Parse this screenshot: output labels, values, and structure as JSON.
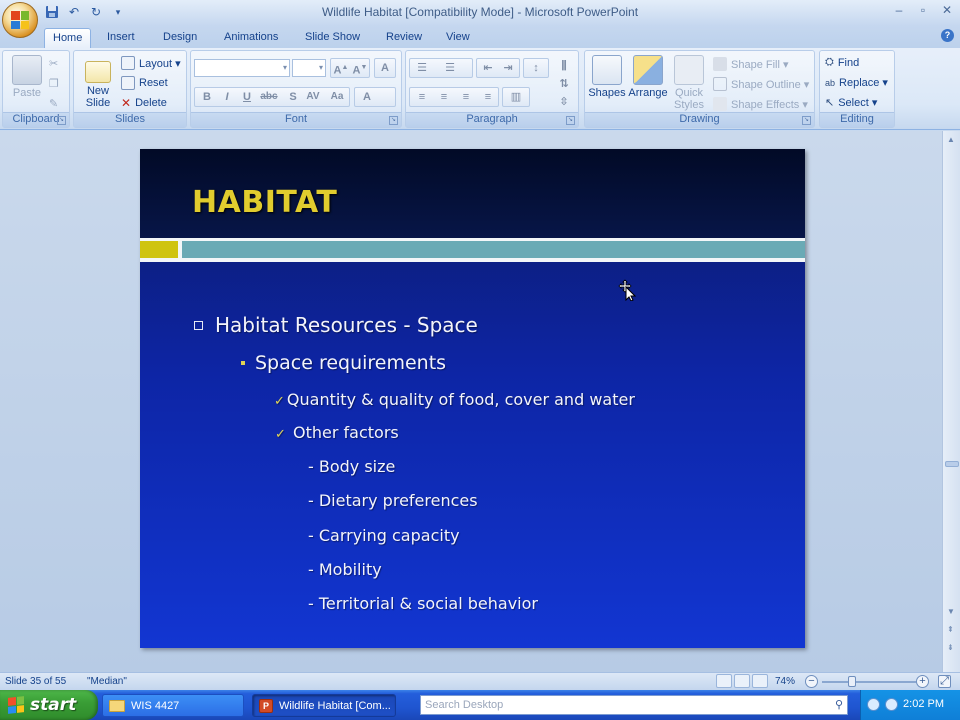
{
  "window": {
    "title": "Wildlife Habitat [Compatibility Mode] - Microsoft PowerPoint",
    "controls": [
      "–",
      "▫",
      "✕"
    ]
  },
  "tabs": [
    "Home",
    "Insert",
    "Design",
    "Animations",
    "Slide Show",
    "Review",
    "View"
  ],
  "ribbon": {
    "clipboard": {
      "label": "Clipboard",
      "paste": "Paste"
    },
    "slides": {
      "label": "Slides",
      "new_slide": "New Slide ▾",
      "layout": "Layout ▾",
      "reset": "Reset",
      "delete": "Delete"
    },
    "font": {
      "label": "Font"
    },
    "paragraph": {
      "label": "Paragraph"
    },
    "drawing": {
      "label": "Drawing",
      "shapes": "Shapes",
      "arrange": "Arrange",
      "quick_styles": "Quick Styles ▾",
      "shape_fill": "Shape Fill ▾",
      "shape_outline": "Shape Outline ▾",
      "shape_effects": "Shape Effects ▾"
    },
    "editing": {
      "label": "Editing",
      "find": "Find",
      "replace": "Replace ▾",
      "select": "Select ▾"
    }
  },
  "slide": {
    "title": "HABITAT",
    "lines": [
      {
        "level": 1,
        "text": "Habitat Resources - Space"
      },
      {
        "level": 2,
        "text": "Space requirements"
      },
      {
        "level": 3,
        "text": "Quantity & quality of food, cover and water"
      },
      {
        "level": 3,
        "text": "Other factors"
      },
      {
        "level": 4,
        "text": "- Body size"
      },
      {
        "level": 4,
        "text": "- Dietary preferences"
      },
      {
        "level": 4,
        "text": "- Carrying capacity"
      },
      {
        "level": 4,
        "text": "- Mobility"
      },
      {
        "level": 4,
        "text": "- Territorial & social behavior"
      }
    ]
  },
  "status": {
    "slide_info": "Slide 35 of 55",
    "theme": "\"Median\"",
    "zoom": "74%"
  },
  "taskbar": {
    "start": "start",
    "tasks": [
      "WIS 4427",
      "Wildlife Habitat [Com..."
    ],
    "search_placeholder": "Search Desktop",
    "clock": "2:02 PM"
  },
  "colors": {
    "slide_title": "#e1cc2e",
    "slide_bg": "#0d25a5",
    "accent_teal": "#6aaab5",
    "accent_yellow": "#cfc410"
  }
}
